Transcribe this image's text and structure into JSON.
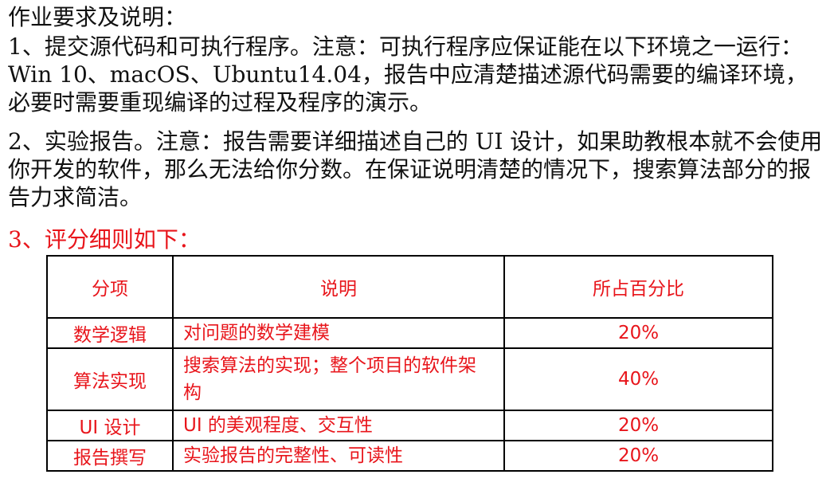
{
  "heading": "作业要求及说明：",
  "item1": "1、提交源代码和可执行程序。注意：可执行程序应保证能在以下环境之一运行：  Win 10、macOS、Ubuntu14.04，报告中应清楚描述源代码需要的编译环境，必要时需要重现编译的过程及程序的演示。",
  "item2": "2、实验报告。注意：报告需要详细描述自己的 UI 设计，如果助教根本就不会使用你开发的软件，那么无法给你分数。在保证说明清楚的情况下，搜索算法部分的报告力求简洁。",
  "item3": "3、评分细则如下：",
  "accent_color": "#e8151b",
  "table": {
    "headers": [
      "分项",
      "说明",
      "所占百分比"
    ],
    "rows": [
      {
        "category": "数学逻辑",
        "description": "对问题的数学建模",
        "percent": "20%"
      },
      {
        "category": "算法实现",
        "description": "搜索算法的实现；整个项目的软件架构",
        "percent": "40%"
      },
      {
        "category": "UI 设计",
        "description": "UI 的美观程度、交互性",
        "percent": "20%"
      },
      {
        "category": "报告撰写",
        "description": "实验报告的完整性、可读性",
        "percent": "20%"
      }
    ]
  }
}
